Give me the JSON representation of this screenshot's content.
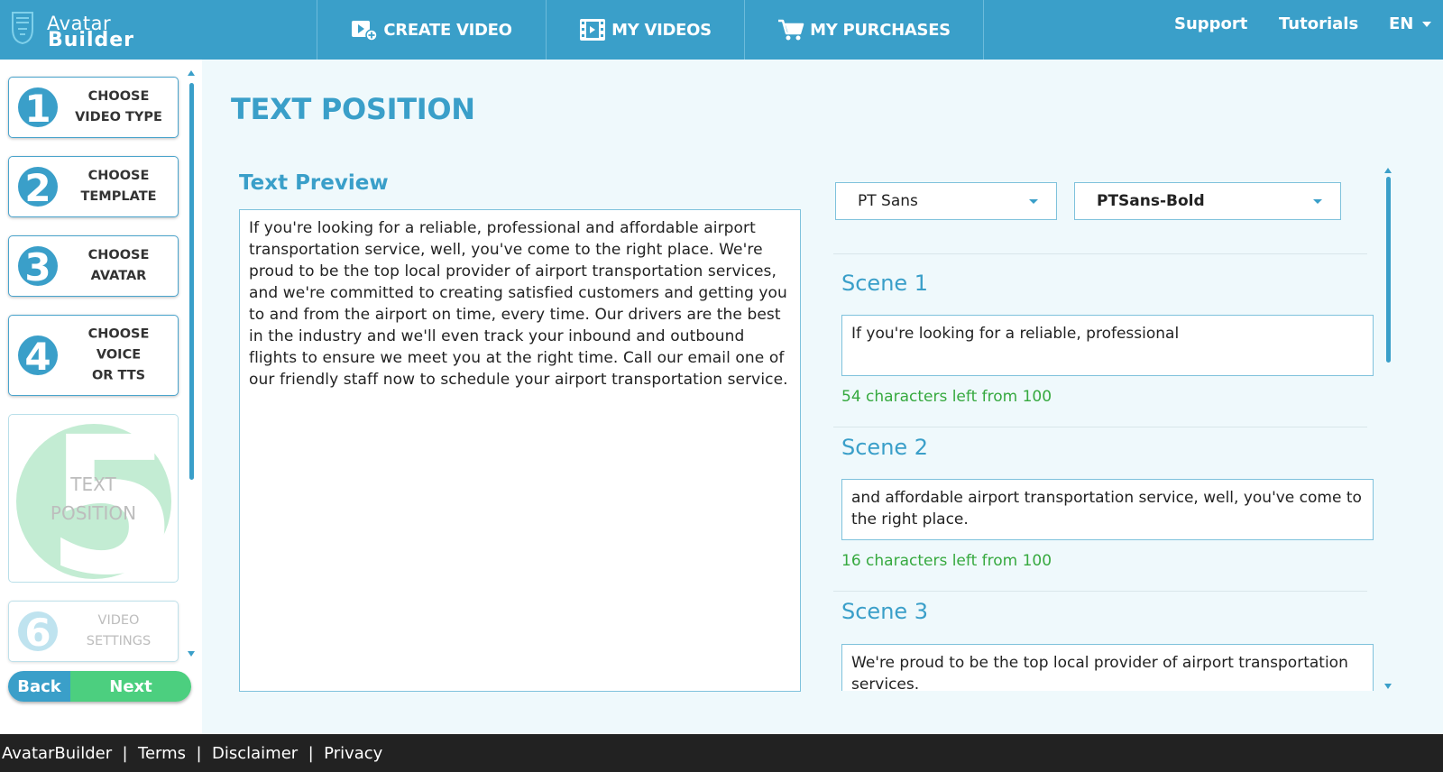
{
  "brand": {
    "line1": "Avatar",
    "line2": "Builder"
  },
  "nav": {
    "create_video": "CREATE VIDEO",
    "my_videos": "MY VIDEOS",
    "my_purchases": "MY PURCHASES",
    "support": "Support",
    "tutorials": "Tutorials",
    "language": "EN"
  },
  "steps": [
    {
      "number": "1",
      "label": "CHOOSE\nVIDEO TYPE",
      "state": "done"
    },
    {
      "number": "2",
      "label": "CHOOSE\nTEMPLATE",
      "state": "done"
    },
    {
      "number": "3",
      "label": "CHOOSE\nAVATAR",
      "state": "done"
    },
    {
      "number": "4",
      "label": "CHOOSE\nVOICE\nOR TTS",
      "state": "done"
    },
    {
      "number": "5",
      "label": "TEXT\nPOSITION",
      "state": "active"
    },
    {
      "number": "6",
      "label": "VIDEO\nSETTINGS",
      "state": "disabled"
    }
  ],
  "buttons": {
    "back": "Back",
    "next": "Next"
  },
  "page_title": "TEXT POSITION",
  "preview": {
    "title": "Text Preview",
    "text": "If you're looking for a reliable, professional   and affordable airport transportation service, well, you've come to the right place.   We're proud to be the top local provider of airport transportation services,   and we're committed to creating satisfied customers and getting you to   and from the airport on time, every time.   Our drivers are the best in the industry and we'll even track your inbound   and outbound flights to ensure we meet you at the right time.   Call our email one of our friendly staff now to schedule your airport transportation service."
  },
  "font_family_select": "PT Sans",
  "font_style_select": "PTSans-Bold",
  "scenes": [
    {
      "title": "Scene 1",
      "text": "If you're looking for a reliable, professional",
      "chars_left": "54 characters left from 100"
    },
    {
      "title": "Scene 2",
      "text": "and affordable airport transportation service, well, you've come to the right place.",
      "chars_left": "16 characters left from 100"
    },
    {
      "title": "Scene 3",
      "text": "We're proud to be the top local provider of airport transportation services.",
      "chars_left": ""
    }
  ],
  "footer": {
    "brand": "AvatarBuilder",
    "sep": "  |  ",
    "terms": "Terms",
    "disclaimer": "Disclaimer",
    "privacy": "Privacy"
  },
  "colors": {
    "primary": "#3a9fc9",
    "accent_green": "#4ccf7f",
    "success_text": "#36a93f",
    "footer_bg": "#222222"
  }
}
